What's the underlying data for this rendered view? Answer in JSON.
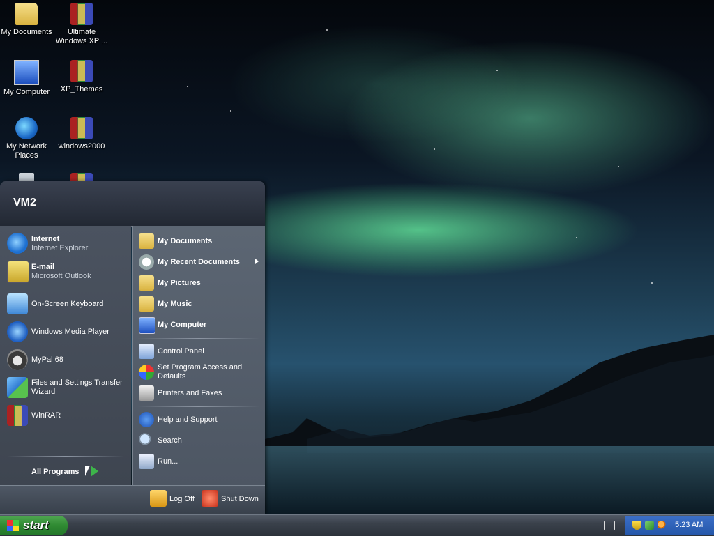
{
  "desktop": {
    "icons": [
      {
        "label": "My Documents",
        "icon": "my-documents-folder-icon"
      },
      {
        "label": "Ultimate Windows XP ...",
        "icon": "winrar-archive-icon"
      },
      {
        "label": "My Computer",
        "icon": "my-computer-icon"
      },
      {
        "label": "XP_Themes",
        "icon": "winrar-archive-icon"
      },
      {
        "label": "My Network Places",
        "icon": "network-globe-icon"
      },
      {
        "label": "windows2000",
        "icon": "winrar-archive-icon"
      },
      {
        "label": "",
        "icon": "recycle-bin-icon"
      },
      {
        "label": "",
        "icon": "winrar-archive-icon"
      }
    ]
  },
  "start_menu": {
    "user_name": "VM2",
    "pinned": [
      {
        "title": "Internet",
        "subtitle": "Internet Explorer",
        "icon": "internet-explorer-icon"
      },
      {
        "title": "E-mail",
        "subtitle": "Microsoft Outlook",
        "icon": "outlook-icon"
      }
    ],
    "recent": [
      {
        "label": "On-Screen Keyboard",
        "icon": "keyboard-icon"
      },
      {
        "label": "Windows Media Player",
        "icon": "media-player-icon"
      },
      {
        "label": "MyPal 68",
        "icon": "mypal-icon"
      },
      {
        "label": "Files and Settings Transfer Wizard",
        "icon": "transfer-wizard-icon"
      },
      {
        "label": "WinRAR",
        "icon": "winrar-icon"
      }
    ],
    "all_programs": "All Programs",
    "right": [
      {
        "label": "My Documents",
        "bold": true,
        "icon": "documents-folder-icon"
      },
      {
        "label": "My Recent Documents",
        "bold": true,
        "icon": "recent-documents-icon",
        "submenu": true
      },
      {
        "label": "My Pictures",
        "bold": true,
        "icon": "pictures-folder-icon"
      },
      {
        "label": "My Music",
        "bold": true,
        "icon": "music-folder-icon"
      },
      {
        "label": "My Computer",
        "bold": true,
        "icon": "computer-icon"
      },
      {
        "label": "Control Panel",
        "bold": false,
        "icon": "control-panel-icon"
      },
      {
        "label": "Set Program Access and Defaults",
        "bold": false,
        "icon": "program-access-icon"
      },
      {
        "label": "Printers and Faxes",
        "bold": false,
        "icon": "printer-icon"
      },
      {
        "label": "Help and Support",
        "bold": false,
        "icon": "help-icon"
      },
      {
        "label": "Search",
        "bold": false,
        "icon": "search-icon"
      },
      {
        "label": "Run...",
        "bold": false,
        "icon": "run-icon"
      }
    ],
    "log_off": "Log Off",
    "shut_down": "Shut Down"
  },
  "taskbar": {
    "start_label": "start",
    "clock": "5:23 AM"
  },
  "colors": {
    "start_green": "#2f8a32",
    "menu_dark": "#3e4550",
    "tray_blue": "#2456a8"
  }
}
